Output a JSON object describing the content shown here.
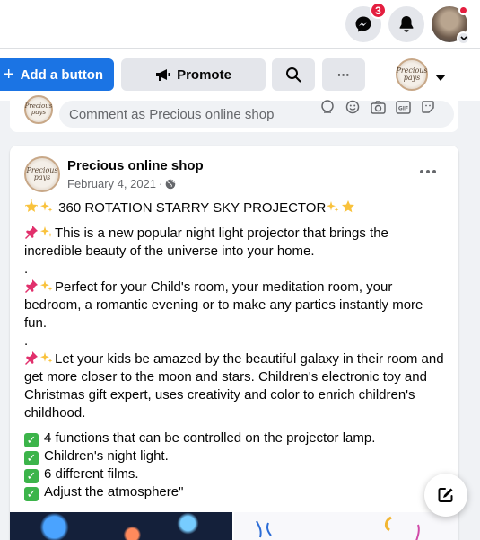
{
  "header": {
    "messenger_badge": "3"
  },
  "actions": {
    "add_button_label": "Add a button",
    "promote_label": "Promote",
    "more_label": "···"
  },
  "page": {
    "name": "Precious online shop",
    "avatar_text": "Precious pays"
  },
  "comment": {
    "placeholder": "Comment as Precious online shop"
  },
  "post": {
    "author": "Precious online shop",
    "date": "February 4, 2021",
    "audience_icon": "globe-icon",
    "headline": "360 ROTATION STARRY SKY PROJECTOR",
    "paragraph1": "This is a new popular  night light projector that brings the incredible beauty of the universe into your home.",
    "dot1": ".",
    "paragraph2": "Perfect for your Child's room, your meditation room, your bedroom, a romantic evening or to make any parties instantly more fun.",
    "dot2": ".",
    "paragraph3": "Let your kids be amazed by the beautiful galaxy in their room and get more closer to the moon and stars. Children's electronic toy and Christmas gift expert, uses creativity and color to enrich children's childhood.",
    "checklist": [
      "4 functions that can be controlled on the projector lamp.",
      "Children's night light.",
      "6 different films.",
      "Adjust the atmosphere\""
    ]
  },
  "colors": {
    "primary": "#1b74e4",
    "badge": "#e41e3f",
    "check": "#3cb44a"
  }
}
